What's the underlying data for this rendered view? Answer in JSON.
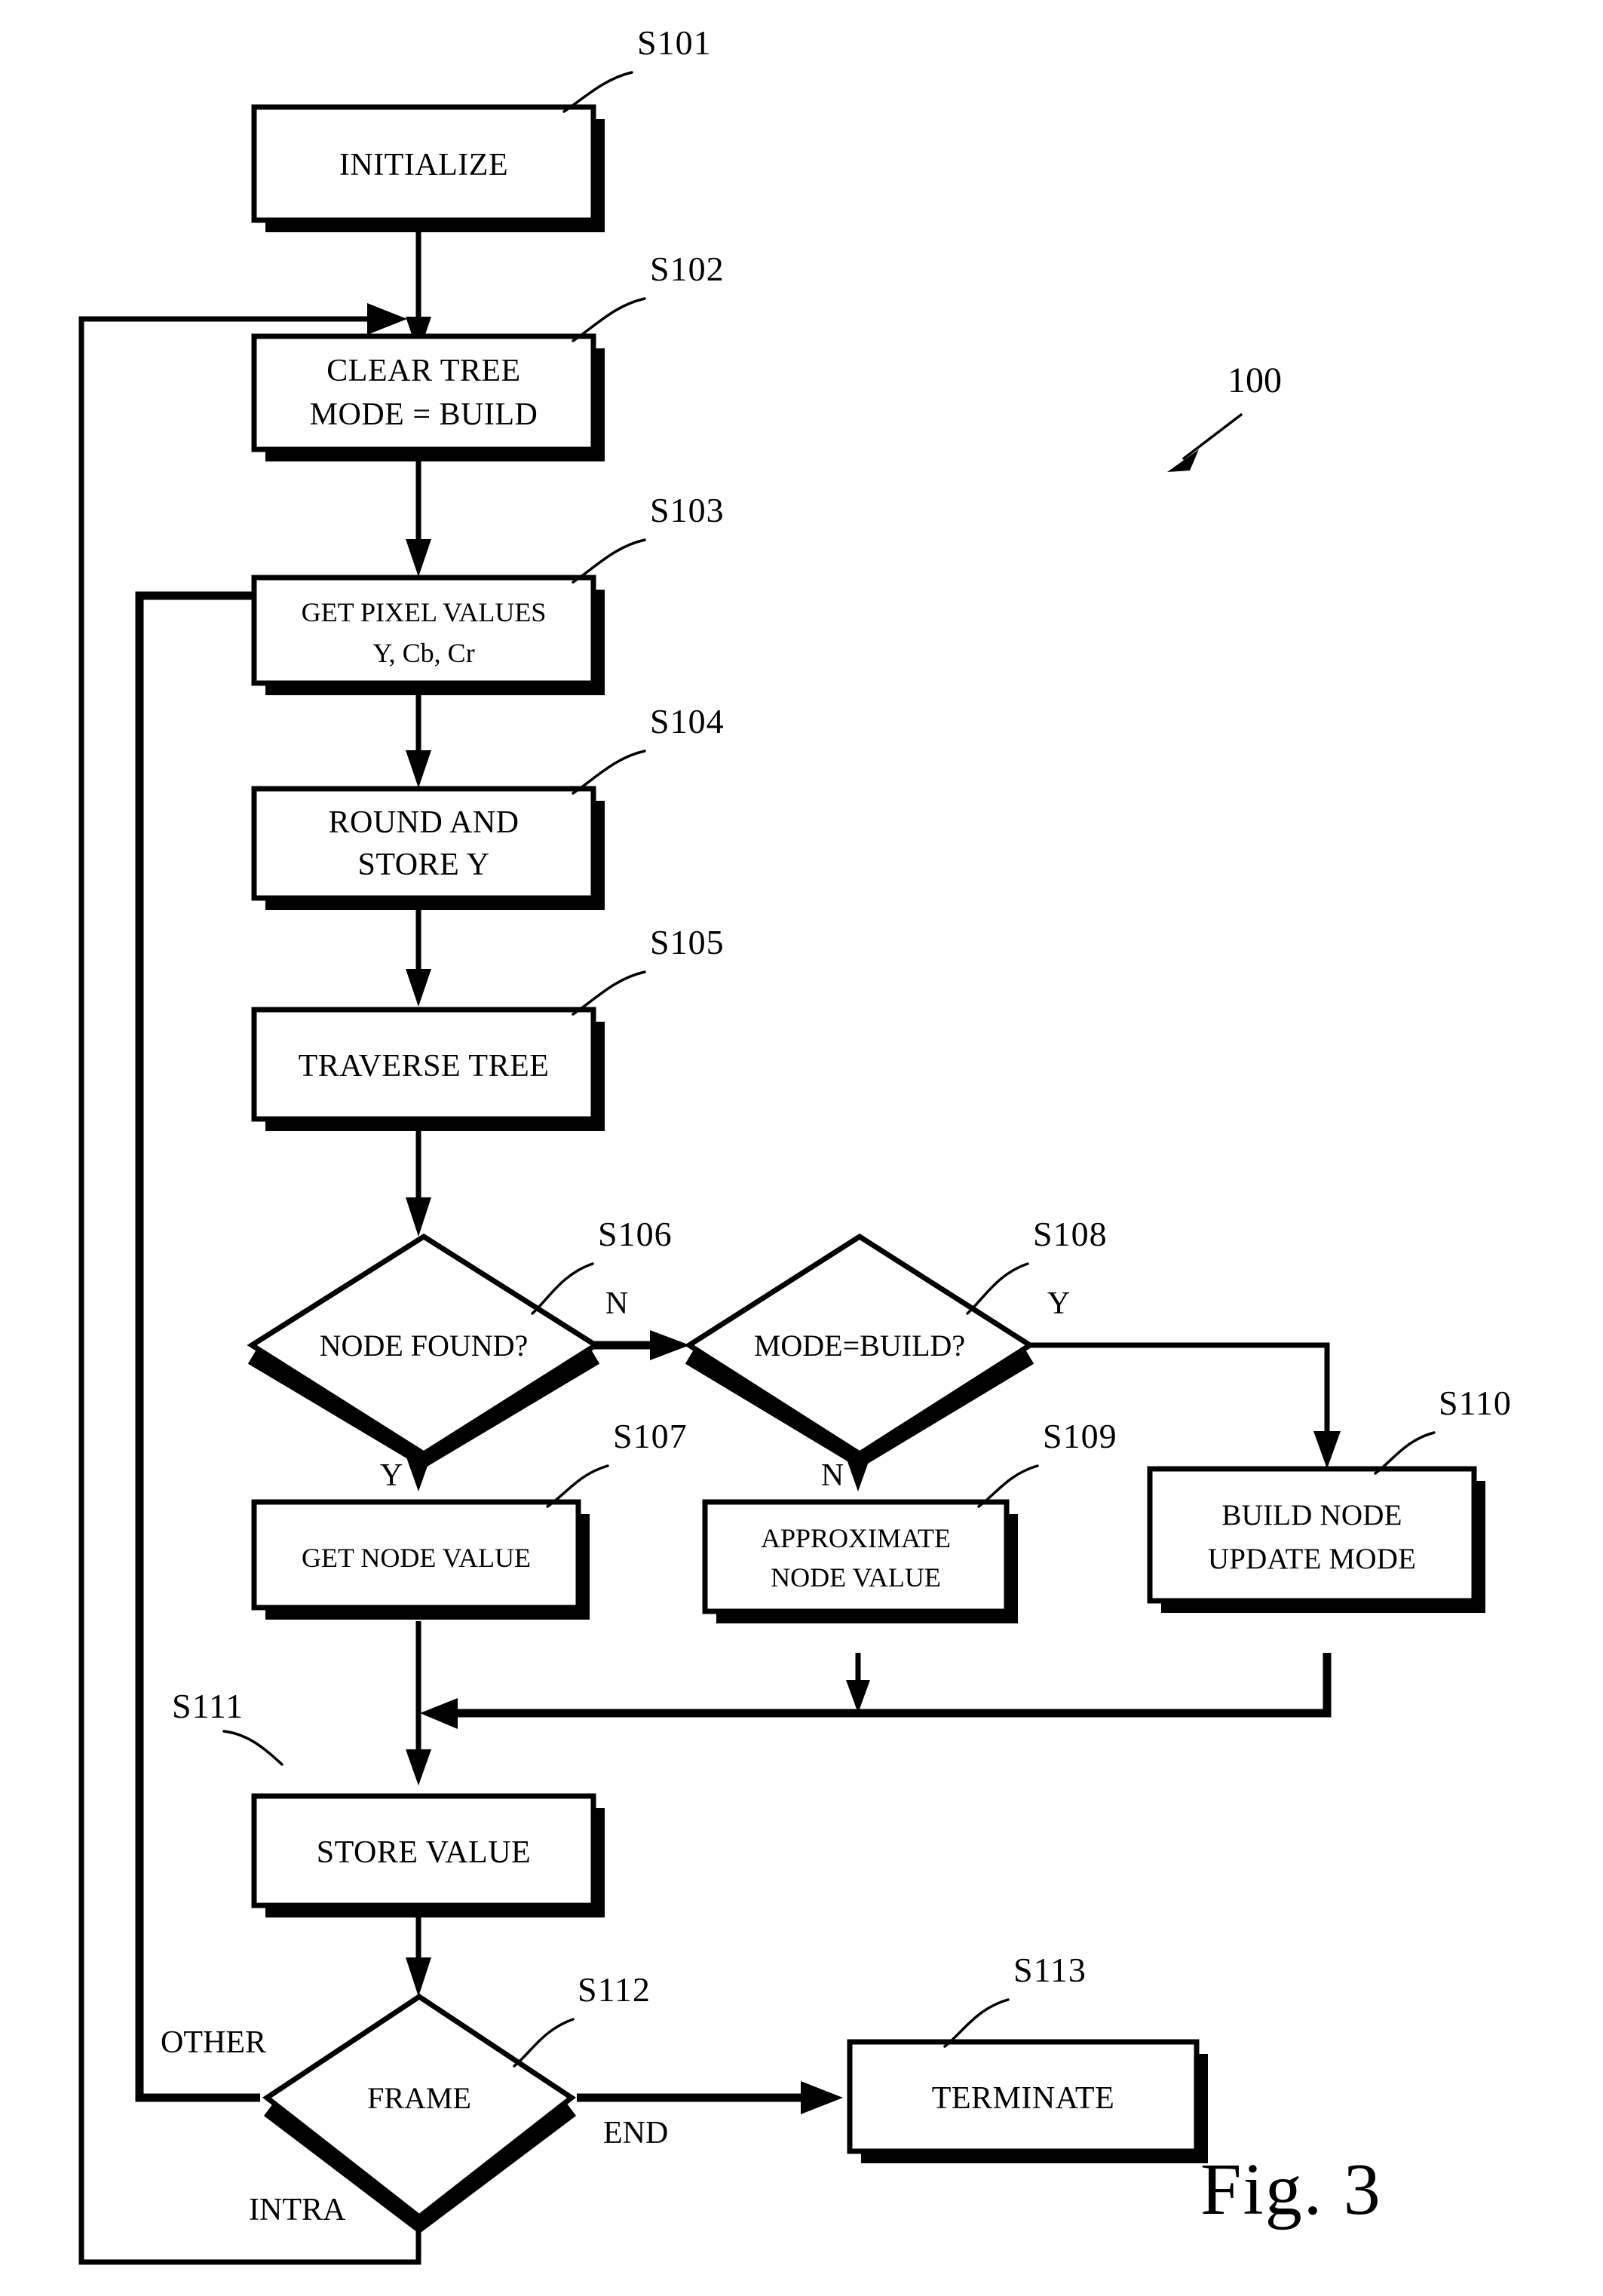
{
  "figure": {
    "caption": "Fig. 3",
    "system_ref": "100"
  },
  "nodes": [
    {
      "id": "S101",
      "ref": "S101",
      "type": "process",
      "lines": [
        "INITIALIZE"
      ]
    },
    {
      "id": "S102",
      "ref": "S102",
      "type": "process",
      "lines": [
        "CLEAR TREE",
        "MODE = BUILD"
      ]
    },
    {
      "id": "S103",
      "ref": "S103",
      "type": "process",
      "lines": [
        "GET PIXEL VALUES",
        "Y, Cb, Cr"
      ]
    },
    {
      "id": "S104",
      "ref": "S104",
      "type": "process",
      "lines": [
        "ROUND AND",
        "STORE  Y"
      ]
    },
    {
      "id": "S105",
      "ref": "S105",
      "type": "process",
      "lines": [
        "TRAVERSE TREE"
      ]
    },
    {
      "id": "S106",
      "ref": "S106",
      "type": "decision",
      "lines": [
        "NODE FOUND?"
      ]
    },
    {
      "id": "S107",
      "ref": "S107",
      "type": "process",
      "lines": [
        "GET NODE VALUE"
      ]
    },
    {
      "id": "S108",
      "ref": "S108",
      "type": "decision",
      "lines": [
        "MODE=BUILD?"
      ]
    },
    {
      "id": "S109",
      "ref": "S109",
      "type": "process",
      "lines": [
        "APPROXIMATE",
        "NODE VALUE"
      ]
    },
    {
      "id": "S110",
      "ref": "S110",
      "type": "process",
      "lines": [
        "BUILD NODE",
        "UPDATE MODE"
      ]
    },
    {
      "id": "S111",
      "ref": "S111",
      "type": "process",
      "lines": [
        "STORE VALUE"
      ]
    },
    {
      "id": "S112",
      "ref": "S112",
      "type": "decision",
      "lines": [
        "FRAME"
      ]
    },
    {
      "id": "S113",
      "ref": "S113",
      "type": "process",
      "lines": [
        "TERMINATE"
      ]
    }
  ],
  "branch_labels": {
    "s106_no": "N",
    "s106_yes": "Y",
    "s108_yes": "Y",
    "s108_no": "N",
    "s112_other": "OTHER",
    "s112_intra": "INTRA",
    "s112_end": "END"
  }
}
